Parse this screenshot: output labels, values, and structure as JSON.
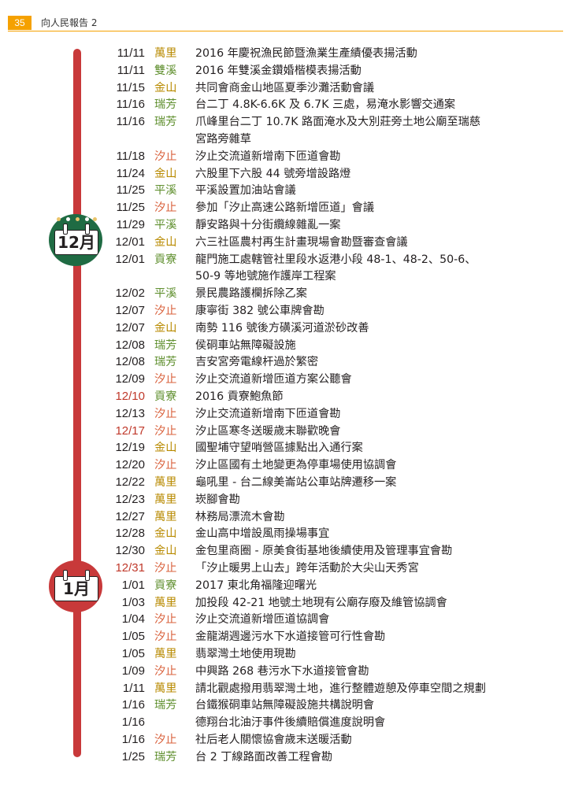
{
  "header": {
    "page_number": "35",
    "report_title": "向人民報告 2"
  },
  "months": [
    {
      "label": "12月",
      "color": "#1f6b43"
    },
    {
      "label": "1月",
      "color": "#c8393a"
    }
  ],
  "colors": {
    "timeline": "#c8393a",
    "accent": "#f5a100",
    "date_highlight": "#c0392b"
  },
  "events": [
    {
      "date": "11/11",
      "town": "萬里",
      "desc": "2016 年慶祝漁民節暨漁業生產績優表揚活動"
    },
    {
      "date": "11/11",
      "town": "雙溪",
      "desc": "2016 年雙溪金鑽婚楷模表揚活動"
    },
    {
      "date": "11/15",
      "town": "金山",
      "desc": "共同會商金山地區夏季沙灘活動會議"
    },
    {
      "date": "11/16",
      "town": "瑞芳",
      "desc": "台二丁 4.8K-6.6K 及 6.7K 三處，易淹水影響交通案"
    },
    {
      "date": "11/16",
      "town": "瑞芳",
      "desc": "爪峰里台二丁 10.7K 路面淹水及大別莊旁土地公廟至瑞慈",
      "desc2": "宮路旁雜草"
    },
    {
      "date": "11/18",
      "town": "汐止",
      "desc": "汐止交流道新增南下匝道會勘"
    },
    {
      "date": "11/24",
      "town": "金山",
      "desc": "六股里下六股 44 號旁增設路燈"
    },
    {
      "date": "11/25",
      "town": "平溪",
      "desc": "平溪設置加油站會議"
    },
    {
      "date": "11/25",
      "town": "汐止",
      "desc": "參加「汐止高速公路新增匝道」會議"
    },
    {
      "date": "11/29",
      "town": "平溪",
      "desc": "靜安路與十分街纜線雜亂一案"
    },
    {
      "date": "12/01",
      "town": "金山",
      "desc": "六三社區農村再生計畫現場會勘暨審查會議"
    },
    {
      "date": "12/01",
      "town": "貢寮",
      "desc": "龍門施工處轄管社里段水返港小段 48-1、48-2、50-6、",
      "desc2": "50-9 等地號施作護岸工程案"
    },
    {
      "date": "12/02",
      "town": "平溪",
      "desc": "景民農路護欄拆除乙案"
    },
    {
      "date": "12/07",
      "town": "汐止",
      "desc": "康寧街 382 號公車牌會勘"
    },
    {
      "date": "12/07",
      "town": "金山",
      "desc": "南勢 116 號後方磺溪河道淤砂改善"
    },
    {
      "date": "12/08",
      "town": "瑞芳",
      "desc": "侯硐車站無障礙設施"
    },
    {
      "date": "12/08",
      "town": "瑞芳",
      "desc": "吉安宮旁電線杆過於繁密"
    },
    {
      "date": "12/09",
      "town": "汐止",
      "desc": "汐止交流道新增匝道方案公聽會"
    },
    {
      "date": "12/10",
      "town": "貢寮",
      "desc": "2016 貢寮鮑魚節"
    },
    {
      "date": "12/13",
      "town": "汐止",
      "desc": "汐止交流道新增南下匝道會勘"
    },
    {
      "date": "12/17",
      "town": "汐止",
      "desc": "汐止區寒冬送暖歲末聯歡晚會"
    },
    {
      "date": "12/19",
      "town": "金山",
      "desc": "國聖埔守望哨營區據點出入通行案"
    },
    {
      "date": "12/20",
      "town": "汐止",
      "desc": "汐止區國有土地變更為停車場使用協調會"
    },
    {
      "date": "12/22",
      "town": "萬里",
      "desc": "龜吼里 - 台二線美崙站公車站牌遷移一案"
    },
    {
      "date": "12/23",
      "town": "萬里",
      "desc": "崁腳會勘"
    },
    {
      "date": "12/27",
      "town": "萬里",
      "desc": "林務局漂流木會勘"
    },
    {
      "date": "12/28",
      "town": "金山",
      "desc": "金山高中增設風雨操場事宜"
    },
    {
      "date": "12/30",
      "town": "金山",
      "desc": "金包里商圈 - 原美食街基地後續使用及管理事宜會勘"
    },
    {
      "date": "12/31",
      "town": "汐止",
      "desc": "「汐止暖男上山去」跨年活動於大尖山天秀宮"
    },
    {
      "date": "1/01",
      "town": "貢寮",
      "desc": "2017 東北角福隆迎曙光"
    },
    {
      "date": "1/03",
      "town": "萬里",
      "desc": "加投段 42-21 地號土地現有公廟存廢及維管協調會"
    },
    {
      "date": "1/04",
      "town": "汐止",
      "desc": "汐止交流道新增匝道協調會"
    },
    {
      "date": "1/05",
      "town": "汐止",
      "desc": "金龍湖週邊污水下水道接管可行性會勘"
    },
    {
      "date": "1/05",
      "town": "萬里",
      "desc": "翡翠灣土地使用現勘"
    },
    {
      "date": "1/09",
      "town": "汐止",
      "desc": "中興路 268 巷污水下水道接管會勘"
    },
    {
      "date": "1/11",
      "town": "萬里",
      "desc": "請北觀處撥用翡翠灣土地，進行整體遊憩及停車空間之規劃"
    },
    {
      "date": "1/16",
      "town": "瑞芳",
      "desc": "台鐵猴硐車站無障礙設施共構說明會"
    },
    {
      "date": "1/16",
      "town": "",
      "desc": "德翔台北油汙事件後續賠償進度說明會"
    },
    {
      "date": "1/16",
      "town": "汐止",
      "desc": "社后老人關懷協會歲末送暖活動"
    },
    {
      "date": "1/25",
      "town": "瑞芳",
      "desc": "台 2 丁線路面改善工程會勘"
    }
  ]
}
